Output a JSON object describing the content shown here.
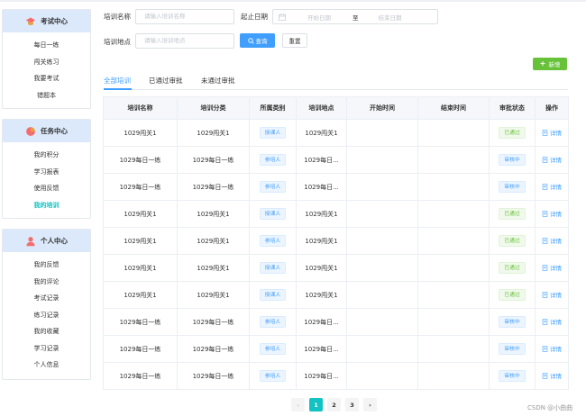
{
  "sidebar": {
    "exam": {
      "title": "考试中心",
      "items": [
        "每日一练",
        "闯关练习",
        "我要考试",
        "错题本"
      ]
    },
    "task": {
      "title": "任务中心",
      "items": [
        "我的积分",
        "学习报表",
        "使用反馈",
        "我的培训"
      ]
    },
    "personal": {
      "title": "个人中心",
      "items": [
        "我的反馈",
        "我的评论",
        "考试记录",
        "练习记录",
        "我的收藏",
        "学习记录",
        "个人信息"
      ]
    },
    "active_item": "我的培训",
    "active_color": "#13c2c2"
  },
  "filters": {
    "name_label": "培训名称",
    "name_placeholder": "请输入培训名称",
    "date_label": "起止日期",
    "start_placeholder": "开始日期",
    "range_separator": "至",
    "end_placeholder": "结束日期",
    "place_label": "培训地点",
    "place_placeholder": "请输入培训地点",
    "query_label": "查询",
    "reset_label": "重置",
    "add_label": "新增"
  },
  "tabs": [
    "全部培训",
    "已通过审批",
    "未通过审批"
  ],
  "table": {
    "headers": [
      "培训名称",
      "培训分类",
      "所属类别",
      "培训地点",
      "开始时间",
      "结束时间",
      "审批状态",
      "操作"
    ],
    "rows": [
      {
        "name": "1029闯关1",
        "category": "1029闯关1",
        "type": "授课人",
        "place": "1029闯关1",
        "start": "",
        "end": "",
        "status": "已通过",
        "action": "详情"
      },
      {
        "name": "1029每日一练",
        "category": "1029每日一练",
        "type": "参培人",
        "place": "1029每日...",
        "start": "",
        "end": "",
        "status": "审核中",
        "action": "详情"
      },
      {
        "name": "1029每日一练",
        "category": "1029每日一练",
        "type": "参培人",
        "place": "1029每日...",
        "start": "",
        "end": "",
        "status": "审核中",
        "action": "详情"
      },
      {
        "name": "1029闯关1",
        "category": "1029闯关1",
        "type": "授课人",
        "place": "1029闯关1",
        "start": "",
        "end": "",
        "status": "已通过",
        "action": "详情"
      },
      {
        "name": "1029闯关1",
        "category": "1029闯关1",
        "type": "参培人",
        "place": "1029闯关1",
        "start": "",
        "end": "",
        "status": "已通过",
        "action": "详情"
      },
      {
        "name": "1029闯关1",
        "category": "1029闯关1",
        "type": "授课人",
        "place": "1029闯关1",
        "start": "",
        "end": "",
        "status": "已通过",
        "action": "详情"
      },
      {
        "name": "1029闯关1",
        "category": "1029闯关1",
        "type": "授课人",
        "place": "1029闯关1",
        "start": "",
        "end": "",
        "status": "已通过",
        "action": "详情"
      },
      {
        "name": "1029每日一练",
        "category": "1029每日一练",
        "type": "参培人",
        "place": "1029每日...",
        "start": "",
        "end": "",
        "status": "审核中",
        "action": "详情"
      },
      {
        "name": "1029每日一练",
        "category": "1029每日一练",
        "type": "参培人",
        "place": "1029每日...",
        "start": "",
        "end": "",
        "status": "审核中",
        "action": "详情"
      },
      {
        "name": "1029每日一练",
        "category": "1029每日一练",
        "type": "参培人",
        "place": "1029每日...",
        "start": "",
        "end": "",
        "status": "审核中",
        "action": "详情"
      }
    ]
  },
  "pagination": {
    "prev": "‹",
    "pages": [
      "1",
      "2",
      "3"
    ],
    "next": "›",
    "current": "1"
  },
  "watermark": "CSDN @小曲曲",
  "colors": {
    "primary": "#409eff",
    "success": "#67c23a",
    "accent": "#13c2c2",
    "side_header_bg": "#dbe9fb"
  },
  "icons": {
    "exam": "graduation-cap-icon",
    "task": "pie-chart-icon",
    "personal": "user-icon",
    "calendar": "calendar-icon",
    "search": "search-icon",
    "add": "plus-icon",
    "detail": "document-icon"
  }
}
